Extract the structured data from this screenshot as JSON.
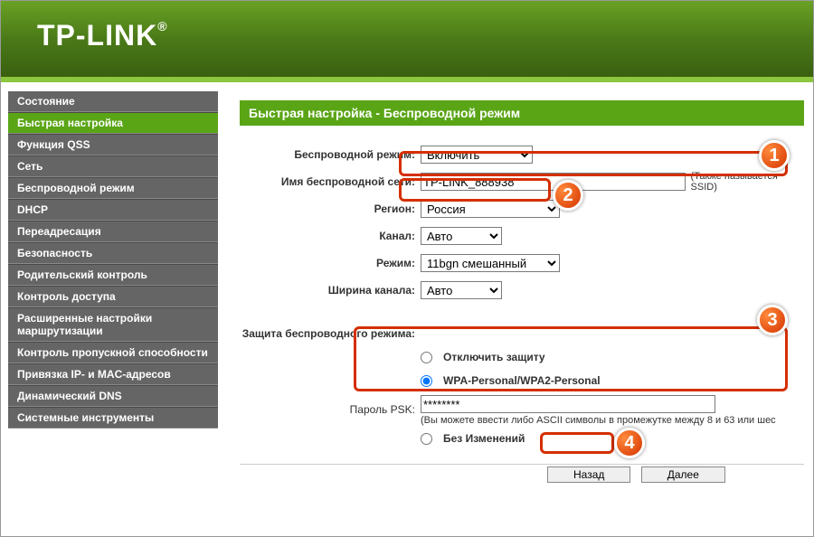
{
  "brand": "TP-LINK",
  "sidebar": {
    "items": [
      "Состояние",
      "Быстрая настройка",
      "Функция QSS",
      "Сеть",
      "Беспроводной режим",
      "DHCP",
      "Переадресация",
      "Безопасность",
      "Родительский контроль",
      "Контроль доступа",
      "Расширенные настройки маршрутизации",
      "Контроль пропускной способности",
      "Привязка IP- и MAC-адресов",
      "Динамический DNS",
      "Системные инструменты"
    ],
    "active_index": 1
  },
  "page": {
    "title": "Быстрая настройка - Беспроводной режим"
  },
  "form": {
    "wireless_mode_label": "Беспроводной режим:",
    "wireless_mode_value": "Включить",
    "ssid_label": "Имя беспроводной сети:",
    "ssid_value": "TP-LINK_888938",
    "ssid_hint": "(Также называется SSID)",
    "region_label": "Регион:",
    "region_value": "Россия",
    "channel_label": "Канал:",
    "channel_value": "Авто",
    "mode_label": "Режим:",
    "mode_value": "11bgn смешанный",
    "width_label": "Ширина канала:",
    "width_value": "Авто",
    "security_label": "Защита беспроводного режима:",
    "sec_opt_disable": "Отключить защиту",
    "sec_opt_wpa": "WPA-Personal/WPA2-Personal",
    "psk_label": "Пароль PSK:",
    "psk_value": "********",
    "psk_hint": "(Вы можете ввести либо ASCII символы в промежутке между 8 и 63 или шес",
    "sec_opt_nochange": "Без Изменений"
  },
  "buttons": {
    "back": "Назад",
    "next": "Далее"
  },
  "markers": {
    "m1": "1",
    "m2": "2",
    "m3": "3",
    "m4": "4"
  }
}
